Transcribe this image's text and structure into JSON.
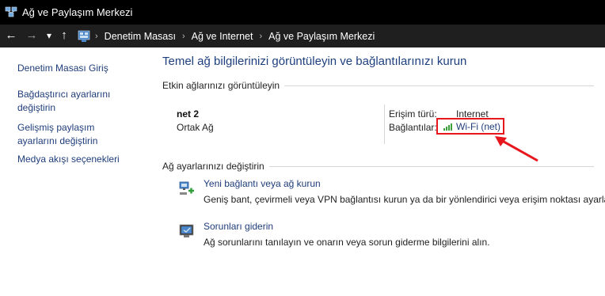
{
  "window": {
    "title": "Ağ ve Paylaşım Merkezi",
    "icon": "network-center-icon"
  },
  "navigation": {
    "back_icon": "←",
    "forward_icon": "→",
    "recent_icon": "▾",
    "up_icon": "↑",
    "breadcrumbs": [
      {
        "label": "Denetim Masası"
      },
      {
        "label": "Ağ ve Internet"
      },
      {
        "label": "Ağ ve Paylaşım Merkezi"
      }
    ]
  },
  "sidebar": {
    "items": [
      {
        "label": "Denetim Masası Giriş"
      },
      {
        "label": "Bağdaştırıcı ayarlarını değiştirin"
      },
      {
        "label": "Gelişmiş paylaşım ayarlarını değiştirin"
      },
      {
        "label": "Medya akışı seçenekleri"
      }
    ]
  },
  "main": {
    "heading": "Temel ağ bilgilerinizi görüntüleyin ve bağlantılarınızı kurun",
    "active_networks_title": "Etkin ağlarınızı görüntüleyin",
    "network": {
      "name": "net 2",
      "category": "Ortak Ağ",
      "access_type_label": "Erişim türü:",
      "access_type_value": "Internet",
      "connections_label": "Bağlantılar:",
      "connection_link": "Wi-Fi (net)"
    },
    "change_settings_title": "Ağ ayarlarınızı değiştirin",
    "tasks": [
      {
        "link": "Yeni bağlantı veya ağ kurun",
        "description": "Geniş bant, çevirmeli veya VPN bağlantısı kurun ya da bir yönlendirici veya erişim noktası ayarlayın."
      },
      {
        "link": "Sorunları giderin",
        "description": "Ağ sorunlarını tanılayın ve onarın veya sorun giderme bilgilerini alın."
      }
    ]
  },
  "annotation": {
    "color": "#e8161d"
  }
}
